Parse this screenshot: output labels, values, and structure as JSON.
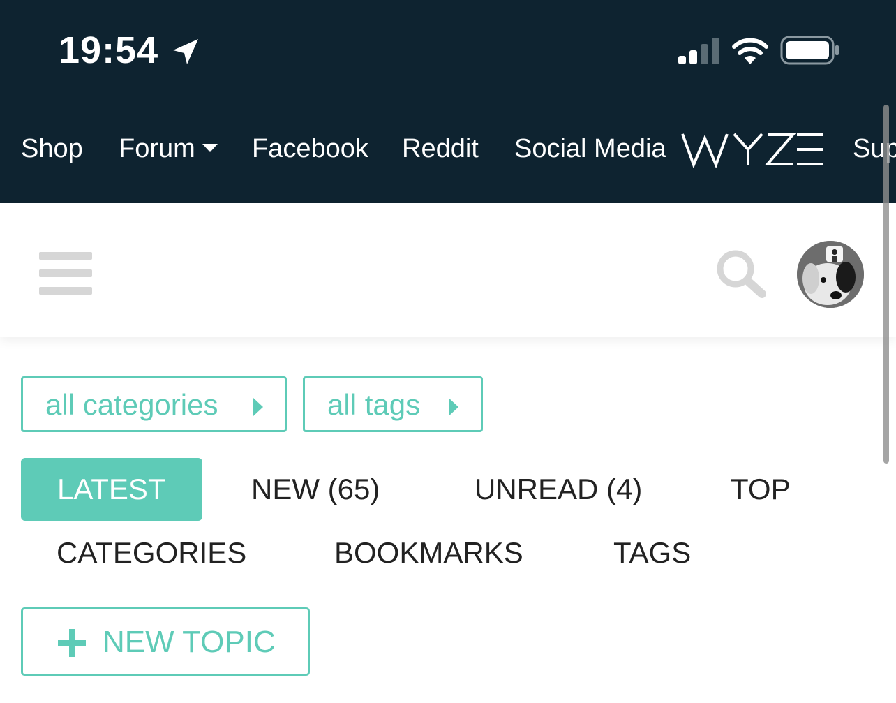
{
  "status_bar": {
    "time": "19:54"
  },
  "top_nav": {
    "shop": "Shop",
    "forum": "Forum",
    "facebook": "Facebook",
    "reddit": "Reddit",
    "social_media": "Social Media",
    "logo_text": "WYZE",
    "support_partial": "Sup"
  },
  "filters": {
    "categories": "all categories",
    "tags": "all tags"
  },
  "tabs": [
    {
      "label": "LATEST",
      "active": true
    },
    {
      "label": "NEW (65)"
    },
    {
      "label": "UNREAD (4)"
    },
    {
      "label": "TOP"
    },
    {
      "label": "CATEGORIES"
    },
    {
      "label": "BOOKMARKS"
    },
    {
      "label": "TAGS"
    }
  ],
  "new_topic": {
    "label": "NEW TOPIC"
  },
  "colors": {
    "nav_background": "#0e2330",
    "accent": "#5ecbb7",
    "icon_gray": "#d6d6d6"
  }
}
